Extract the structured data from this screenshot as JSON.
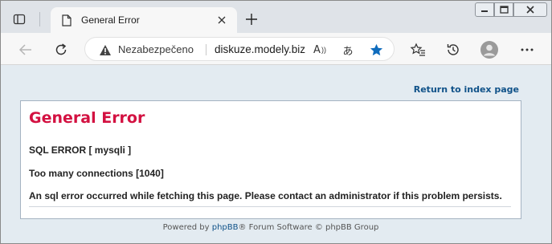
{
  "browser": {
    "tab_title": "General Error",
    "security_label": "Nezabezpečeno",
    "url": "diskuze.modely.biz",
    "read_aloud_glyph": "A",
    "translate_glyph": "あ"
  },
  "page": {
    "return_link": "Return to index page",
    "heading": "General Error",
    "line1": "SQL ERROR [ mysqli ]",
    "line2": "Too many connections [1040]",
    "line3": "An sql error occurred while fetching this page. Please contact an administrator if this problem persists.",
    "footer_prefix": "Powered by ",
    "footer_link": "phpBB",
    "footer_suffix": "® Forum Software © phpBB Group"
  },
  "colors": {
    "heading": "#d31141",
    "link": "#105289",
    "page_bg": "#e3ebf1",
    "favorite_star": "#0f6cbd"
  }
}
